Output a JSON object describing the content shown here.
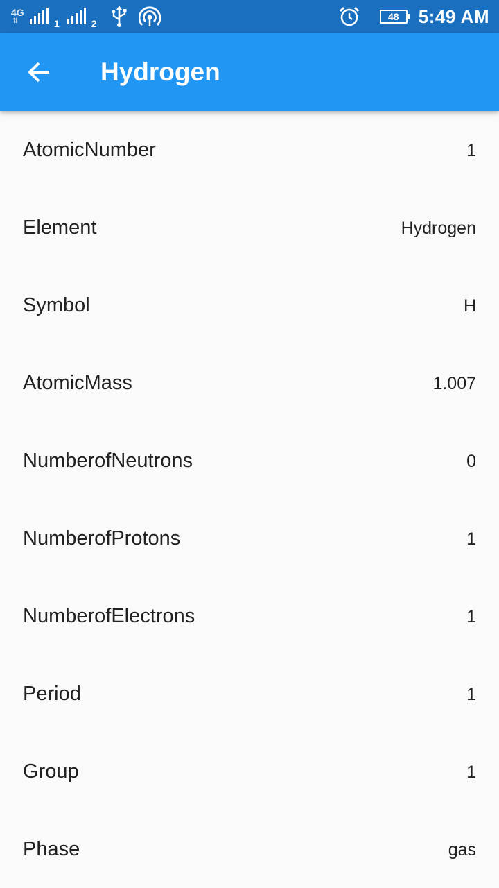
{
  "status_bar": {
    "network_type": "4G",
    "sim1_label": "1",
    "sim2_label": "2",
    "battery_level": "48",
    "time": "5:49 AM",
    "icons": [
      "signal-icon",
      "usb-icon",
      "hotspot-icon",
      "alarm-icon",
      "battery-icon"
    ]
  },
  "app_bar": {
    "title": "Hydrogen",
    "back_icon": "arrow-back-icon",
    "color": "#2196f3"
  },
  "properties": [
    {
      "label": "AtomicNumber",
      "value": "1"
    },
    {
      "label": "Element",
      "value": "Hydrogen"
    },
    {
      "label": "Symbol",
      "value": "H"
    },
    {
      "label": "AtomicMass",
      "value": "1.007"
    },
    {
      "label": "NumberofNeutrons",
      "value": "0"
    },
    {
      "label": "NumberofProtons",
      "value": "1"
    },
    {
      "label": "NumberofElectrons",
      "value": "1"
    },
    {
      "label": "Period",
      "value": "1"
    },
    {
      "label": "Group",
      "value": "1"
    },
    {
      "label": "Phase",
      "value": "gas"
    }
  ]
}
